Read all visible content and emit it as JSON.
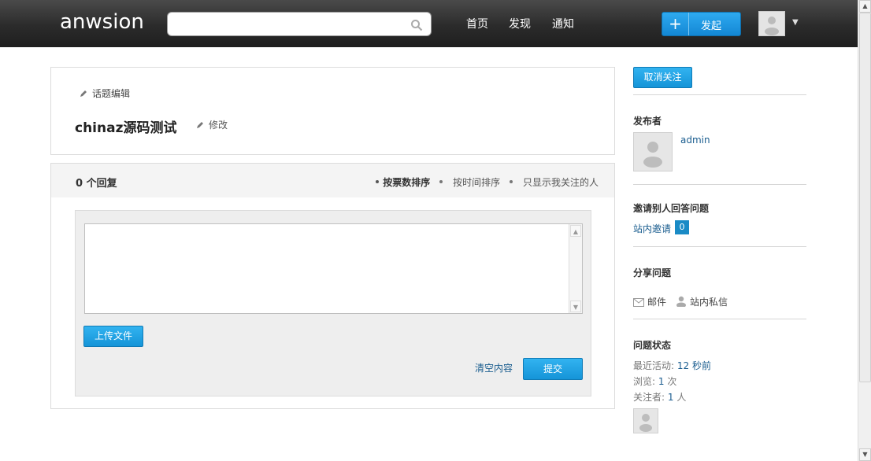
{
  "header": {
    "logo": "anwsion",
    "search": {
      "placeholder": "",
      "value": ""
    },
    "nav": [
      {
        "label": "首页"
      },
      {
        "label": "发现"
      },
      {
        "label": "通知"
      }
    ],
    "publish_label": "发起",
    "publish_plus": "+",
    "caret": "▼"
  },
  "question": {
    "topic_edit_label": "话题编辑",
    "title": "chinaz源码测试",
    "modify_label": "修改"
  },
  "answers": {
    "count_label": "0 个回复",
    "sort": {
      "by_votes": "按票数排序",
      "by_time": "按时间排序",
      "followed_only": "只显示我关注的人"
    },
    "upload_label": "上传文件",
    "clear_label": "清空内容",
    "submit_label": "提交"
  },
  "sidebar": {
    "unfollow_label": "取消关注",
    "publisher_title": "发布者",
    "publisher_name": "admin",
    "invite_title": "邀请别人回答问题",
    "invite_link": "站内邀请",
    "invite_count": "0",
    "share_title": "分享问题",
    "share_mail": "邮件",
    "share_message": "站内私信",
    "status_title": "问题状态",
    "status": {
      "activity_label": "最近活动: ",
      "activity_value": "12 秒前",
      "views_label": "浏览: ",
      "views_value": "1",
      "views_unit": " 次",
      "followers_label": "关注者: ",
      "followers_value": "1",
      "followers_unit": " 人"
    }
  },
  "colors": {
    "accent": "#1594d8",
    "link": "#1a5d8f",
    "header_bg": "#2b2b2b"
  },
  "icons": [
    "search-icon",
    "pencil-icon",
    "plus-icon",
    "mail-icon",
    "user-icon",
    "avatar-placeholder-icon"
  ]
}
